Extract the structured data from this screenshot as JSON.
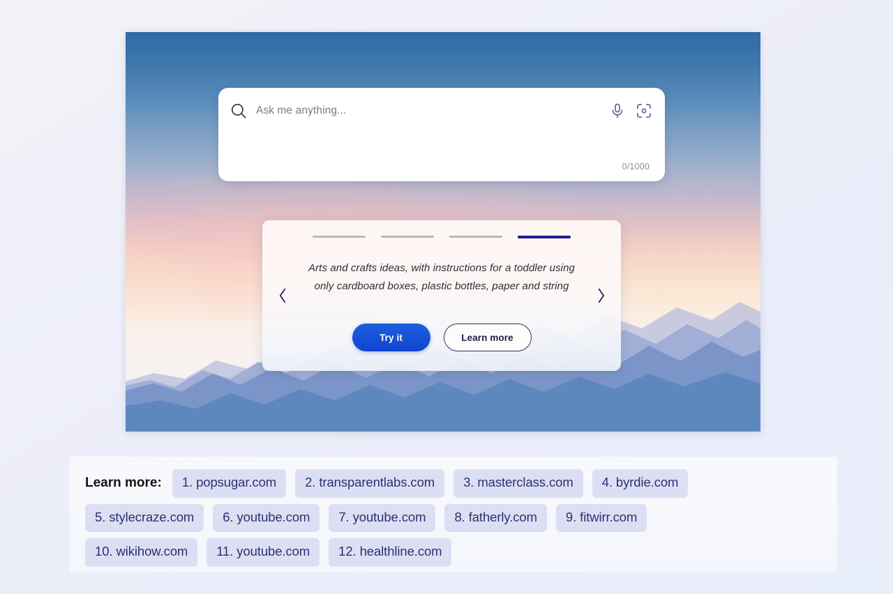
{
  "hero": {
    "search": {
      "placeholder": "Ask me anything...",
      "value": "",
      "char_count": "0/1000",
      "magnifier_icon": "search-icon",
      "mic_icon": "microphone-icon",
      "lens_icon": "visual-search-icon"
    },
    "carousel": {
      "suggestion": "Arts and crafts ideas, with instructions for a toddler using only cardboard boxes, plastic bottles, paper and string",
      "dots": [
        {
          "index": 1,
          "active": false
        },
        {
          "index": 2,
          "active": false
        },
        {
          "index": 3,
          "active": false
        },
        {
          "index": 4,
          "active": true
        }
      ],
      "prev_icon": "chevron-left-icon",
      "next_icon": "chevron-right-icon",
      "primary_button": "Try it",
      "secondary_button": "Learn more"
    }
  },
  "citations": {
    "label": "Learn more:",
    "rows": [
      [
        "1. popsugar.com",
        "2. transparentlabs.com",
        "3. masterclass.com",
        "4. byrdie.com"
      ],
      [
        "5. stylecraze.com",
        "6. youtube.com",
        "7. youtube.com",
        "8. fatherly.com",
        "9. fitwirr.com"
      ],
      [
        "10. wikihow.com",
        "11. youtube.com",
        "12. healthline.com"
      ]
    ]
  },
  "colors": {
    "accent_blue": "#1044cf",
    "active_dot": "#1b1b8f",
    "chip_bg": "#dcdff4",
    "chip_text": "#2b3170",
    "page_bg": "#eeeffa"
  }
}
